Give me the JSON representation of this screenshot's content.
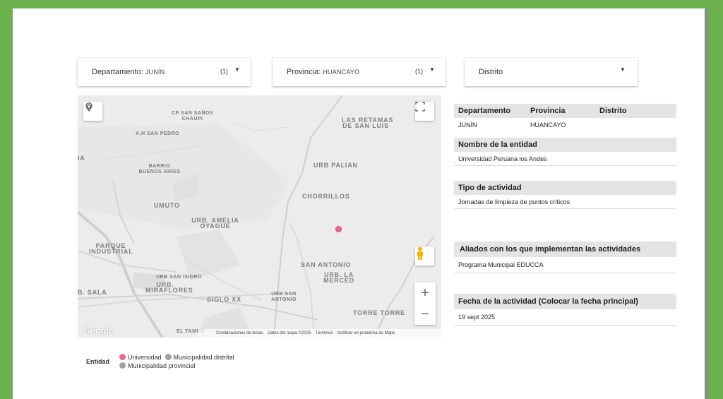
{
  "filters": {
    "departamento": {
      "label": "Departamento:",
      "value": "JUNÍN",
      "count": "(1)"
    },
    "provincia": {
      "label": "Provincia:",
      "value": "HUANCAYO",
      "count": "(1)"
    },
    "distrito": {
      "label": "Distrito"
    }
  },
  "map": {
    "labels": {
      "cp_san_sanos": "CP SAN SAÑOS\nCHAUPI",
      "ah_san_pedro": "A.H SAN PEDRO",
      "las_retamas": "LAS RETAMAS\nDE SAN LUIS",
      "barrio_buenos_aires": "BARRIO\nBUENOS AIRES",
      "urb_palian": "URB PALIAN",
      "umuto": "UMUTO",
      "chorrillos": "CHORRILLOS",
      "urb_amelia": "URB. AMELIA\nOYAGUE",
      "parque_industrial": "PARQUE\nINDUSTRIAL",
      "san_antonio": "SAN ANTONIO",
      "urb_la_merced": "URB. LA\nMERCED",
      "urb_san_isidro": "URB SAN ISIDRO",
      "urb_miraflores": "URB.\nMIRAFLORES",
      "siglo_xx": "SIGLO XX",
      "urb_san_antonio": "URB SAN\nANTONIO",
      "torre_torre": "TORRE TORRE",
      "el_tambo": "EL TAMBO",
      "sala": "B. SALA",
      "ia": "IA"
    },
    "attribution": {
      "shortcuts": "Combinaciones de teclas",
      "data": "Datos del mapa ©2025",
      "terms": "Términos",
      "report": "Notificar un problema de Maps"
    },
    "google": "Google",
    "zoom_in": "+",
    "zoom_out": "−"
  },
  "legend": {
    "title": "Entidad",
    "items": [
      {
        "label": "Universidad",
        "color": "#f06292"
      },
      {
        "label": "Municipalidad distrital",
        "color": "#a0a0a0"
      },
      {
        "label": "Municipalidad provincial",
        "color": "#a0a0a0"
      }
    ]
  },
  "details": {
    "location": {
      "headers": [
        "Departamento",
        "Provincia",
        "Distrito"
      ],
      "values": [
        "JUNÍN",
        "HUANCAYO",
        ""
      ]
    },
    "entidad": {
      "title": "Nombre de la entidad",
      "value": "Universidad Peruana los Andes"
    },
    "tipo": {
      "title": "Tipo de actividad",
      "value": "Jornadas de limpieza de puntos críticos"
    },
    "aliados": {
      "title": "Aliados con los que implementan las actividades",
      "value": "Programa Municipal EDUCCA"
    },
    "fecha": {
      "title": "Fecha de la actividad (Colocar la fecha principal)",
      "value": "19 sept 2025"
    }
  }
}
